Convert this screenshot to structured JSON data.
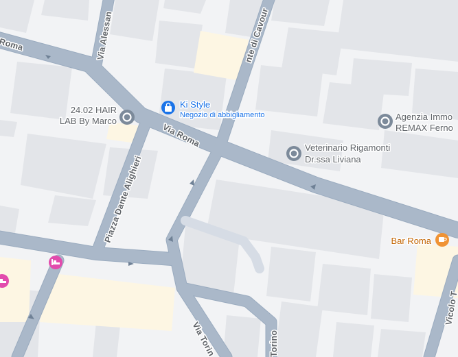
{
  "map": {
    "background_color": "#f2f3f5",
    "road_color": "#aab8c9",
    "road_edge_color": "#9aabbf",
    "building_color": "#e3e5e9",
    "highlight_block_color": "#fdf6e3",
    "streets": {
      "via_roma_west": "Roma",
      "via_roma_center": "Via Roma",
      "via_alessandro": "Via Alessan",
      "via_cavour": "nte di Cavour",
      "piazza_dante": "Piazza Dante Alighieri",
      "via_torino_1": "Via Torin",
      "via_torino_2": "Torino",
      "vicolo": "Vicolo T"
    },
    "pois": {
      "ki_style": {
        "name": "Ki Style",
        "category": "Negozio di abbigliamento",
        "icon": "shopping-bag-icon",
        "color": "#1a73e8"
      },
      "hair_lab": {
        "name_line1": "24.02 HAIR",
        "name_line2": "LAB By Marco",
        "icon": "place-marker-icon",
        "color": "#7c8a9a"
      },
      "agenzia": {
        "name_line1": "Agenzia Immo",
        "name_line2": "REMAX Ferno",
        "icon": "place-marker-icon",
        "color": "#7c8a9a"
      },
      "veterinario": {
        "name_line1": "Veterinario Rigamonti",
        "name_line2": "Dr.ssa Liviana",
        "icon": "place-marker-icon",
        "color": "#7c8a9a"
      },
      "bar_roma": {
        "name": "Bar Roma",
        "icon": "coffee-cup-icon",
        "color": "#f09334"
      },
      "hotel_1": {
        "icon": "bed-icon",
        "color": "#e24bad"
      },
      "hotel_2": {
        "icon": "bed-icon",
        "color": "#e24bad"
      }
    }
  }
}
